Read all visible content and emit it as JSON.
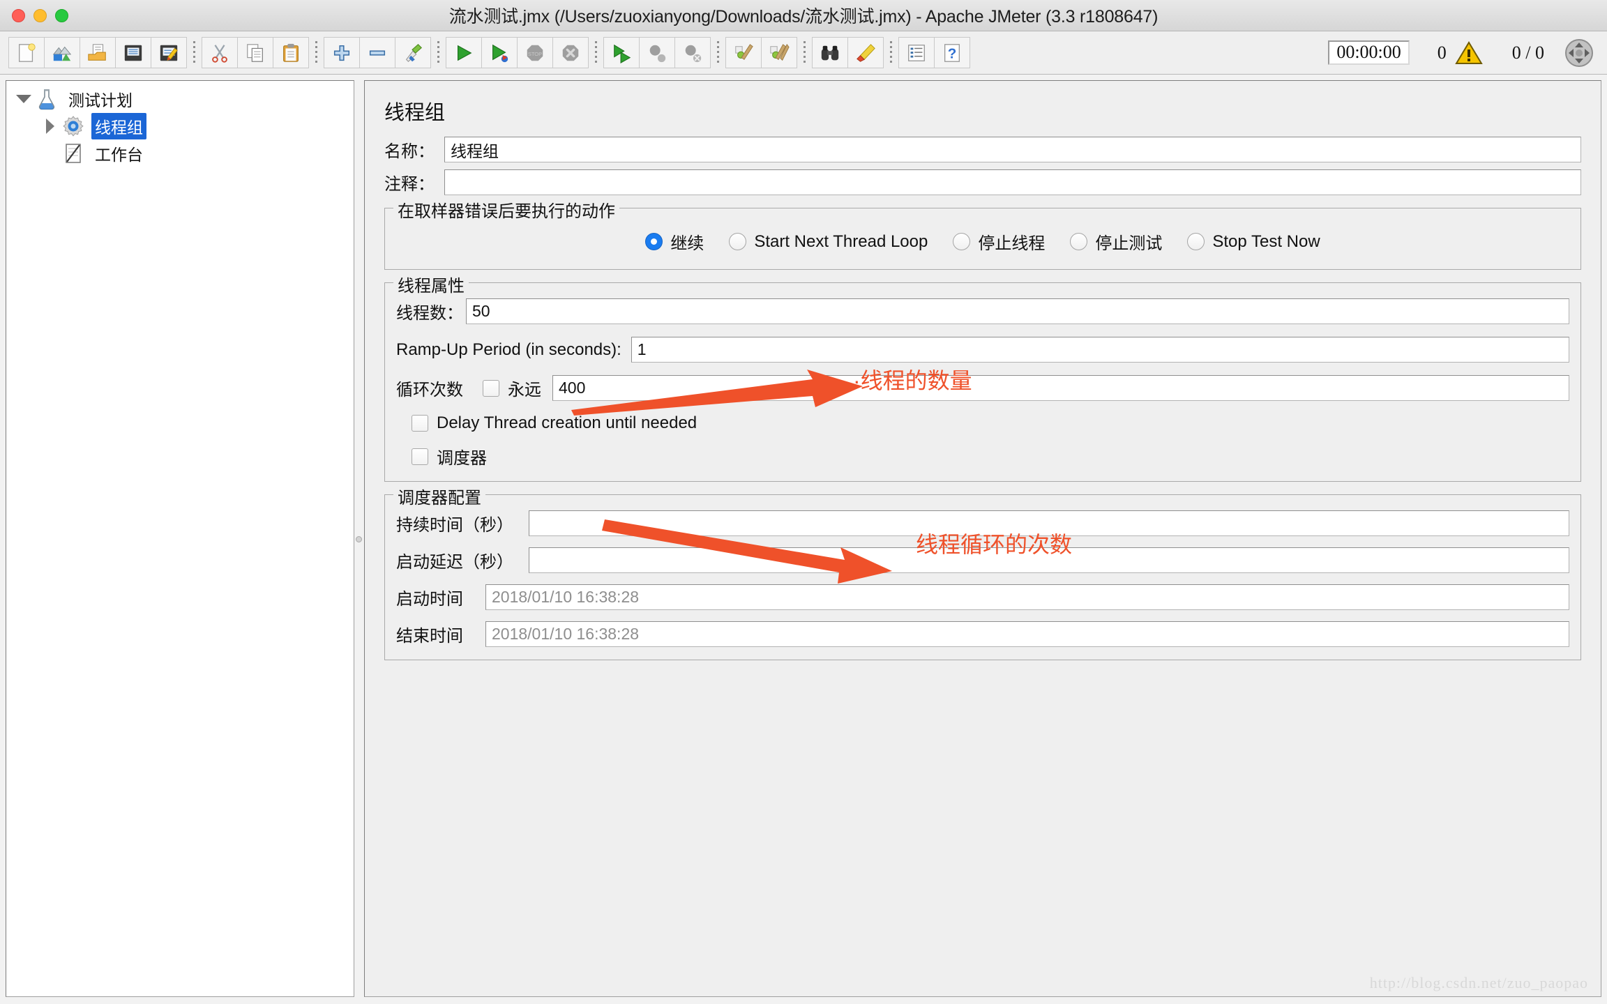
{
  "window": {
    "title": "流水测试.jmx (/Users/zuoxianyong/Downloads/流水测试.jmx) - Apache JMeter (3.3 r1808647)",
    "traffic_lights": [
      "close",
      "minimize",
      "zoom"
    ]
  },
  "toolbar": {
    "buttons": [
      {
        "name": "new-file-button",
        "icon": "new-document-icon",
        "title": "New"
      },
      {
        "name": "templates-button",
        "icon": "templates-icon",
        "title": "Templates"
      },
      {
        "name": "open-button",
        "icon": "open-folder-icon",
        "title": "Open"
      },
      {
        "name": "save-button",
        "icon": "floppy-disk-icon",
        "title": "Save"
      },
      {
        "name": "save-as-button",
        "icon": "floppy-pencil-icon",
        "title": "Save As"
      },
      {
        "name": "cut-button",
        "icon": "scissors-icon",
        "title": "Cut"
      },
      {
        "name": "copy-button",
        "icon": "copy-pages-icon",
        "title": "Copy"
      },
      {
        "name": "paste-button",
        "icon": "clipboard-icon",
        "title": "Paste"
      },
      {
        "name": "expand-all-button",
        "icon": "plus-icon",
        "title": "Expand All"
      },
      {
        "name": "collapse-all-button",
        "icon": "minus-icon",
        "title": "Collapse All"
      },
      {
        "name": "toggle-button",
        "icon": "toggle-pin-icon",
        "title": "Toggle"
      },
      {
        "name": "start-button",
        "icon": "green-play-icon",
        "title": "Start"
      },
      {
        "name": "start-no-pauses-button",
        "icon": "green-play-nopause-icon",
        "title": "Start no pauses"
      },
      {
        "name": "stop-button",
        "icon": "stop-sign-icon",
        "title": "Stop"
      },
      {
        "name": "shutdown-button",
        "icon": "shutdown-x-icon",
        "title": "Shutdown"
      },
      {
        "name": "remote-start-all-button",
        "icon": "remote-play-icon",
        "title": "Remote Start All"
      },
      {
        "name": "remote-stop-all-button",
        "icon": "remote-stop-icon",
        "title": "Remote Stop All"
      },
      {
        "name": "remote-shutdown-all-button",
        "icon": "remote-shutdown-icon",
        "title": "Remote Shutdown All"
      },
      {
        "name": "clear-button",
        "icon": "gear-broom-icon",
        "title": "Clear"
      },
      {
        "name": "clear-all-button",
        "icon": "gear-brooms-icon",
        "title": "Clear All"
      },
      {
        "name": "search-button",
        "icon": "binoculars-icon",
        "title": "Search"
      },
      {
        "name": "reset-search-button",
        "icon": "eraser-icon",
        "title": "Reset Search"
      },
      {
        "name": "function-helper-button",
        "icon": "function-list-icon",
        "title": "Function Helper"
      },
      {
        "name": "help-button",
        "icon": "question-mark-icon",
        "title": "Help"
      }
    ],
    "separators_after": [
      4,
      7,
      10,
      14,
      17,
      19,
      21
    ],
    "timer": "00:00:00",
    "warning_count": "0",
    "warning_icon": "warning-triangle-icon",
    "thread_count": "0 / 0",
    "expand_icon": "four-arrows-icon"
  },
  "tree": {
    "nodes": [
      {
        "label": "测试计划",
        "icon": "flask-icon",
        "twisty": "down",
        "indent": 0,
        "selected": false
      },
      {
        "label": "线程组",
        "icon": "gear-icon",
        "twisty": "right",
        "indent": 1,
        "selected": true
      },
      {
        "label": "工作台",
        "icon": "workbench-icon",
        "twisty": "none",
        "indent": 1,
        "selected": false
      }
    ]
  },
  "main": {
    "title": "线程组",
    "name_label": "名称：",
    "name_value": "线程组",
    "comment_label": "注释：",
    "comment_value": "",
    "error_action": {
      "legend": "在取样器错误后要执行的动作",
      "options": [
        {
          "label": "继续",
          "selected": true
        },
        {
          "label": "Start Next Thread Loop",
          "selected": false
        },
        {
          "label": "停止线程",
          "selected": false
        },
        {
          "label": "停止测试",
          "selected": false
        },
        {
          "label": "Stop Test Now",
          "selected": false
        }
      ]
    },
    "thread_properties": {
      "legend": "线程属性",
      "num_threads_label": "线程数：",
      "num_threads_value": "50",
      "ramp_up_label": "Ramp-Up Period (in seconds):",
      "ramp_up_value": "1",
      "loop_label": "循环次数",
      "forever_label": "永远",
      "forever_checked": false,
      "loop_value": "400",
      "delay_thread_label": "Delay Thread creation until needed",
      "delay_thread_checked": false,
      "scheduler_label": "调度器",
      "scheduler_checked": false
    },
    "scheduler_config": {
      "legend": "调度器配置",
      "duration_label": "持续时间（秒）",
      "duration_value": "",
      "startup_delay_label": "启动延迟（秒）",
      "startup_delay_value": "",
      "start_time_label": "启动时间",
      "start_time_value": "2018/01/10 16:38:28",
      "end_time_label": "结束时间",
      "end_time_value": "2018/01/10 16:38:28"
    }
  },
  "annotations": {
    "accent_color": "#ef512a",
    "items": [
      {
        "text": "·线程的数量",
        "name": "annotation-thread-count"
      },
      {
        "text": "线程循环的次数",
        "name": "annotation-loop-count"
      }
    ]
  },
  "watermark": "http://blog.csdn.net/zuo_paopao"
}
